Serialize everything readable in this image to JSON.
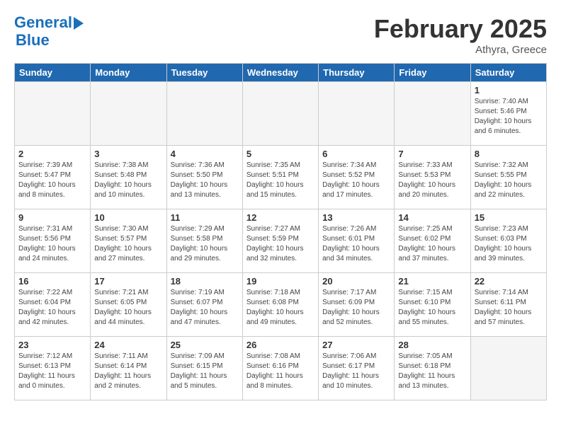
{
  "logo": {
    "line1": "General",
    "line2": "Blue"
  },
  "title": "February 2025",
  "subtitle": "Athyra, Greece",
  "days_of_week": [
    "Sunday",
    "Monday",
    "Tuesday",
    "Wednesday",
    "Thursday",
    "Friday",
    "Saturday"
  ],
  "weeks": [
    [
      {
        "num": "",
        "info": ""
      },
      {
        "num": "",
        "info": ""
      },
      {
        "num": "",
        "info": ""
      },
      {
        "num": "",
        "info": ""
      },
      {
        "num": "",
        "info": ""
      },
      {
        "num": "",
        "info": ""
      },
      {
        "num": "1",
        "info": "Sunrise: 7:40 AM\nSunset: 5:46 PM\nDaylight: 10 hours\nand 6 minutes."
      }
    ],
    [
      {
        "num": "2",
        "info": "Sunrise: 7:39 AM\nSunset: 5:47 PM\nDaylight: 10 hours\nand 8 minutes."
      },
      {
        "num": "3",
        "info": "Sunrise: 7:38 AM\nSunset: 5:48 PM\nDaylight: 10 hours\nand 10 minutes."
      },
      {
        "num": "4",
        "info": "Sunrise: 7:36 AM\nSunset: 5:50 PM\nDaylight: 10 hours\nand 13 minutes."
      },
      {
        "num": "5",
        "info": "Sunrise: 7:35 AM\nSunset: 5:51 PM\nDaylight: 10 hours\nand 15 minutes."
      },
      {
        "num": "6",
        "info": "Sunrise: 7:34 AM\nSunset: 5:52 PM\nDaylight: 10 hours\nand 17 minutes."
      },
      {
        "num": "7",
        "info": "Sunrise: 7:33 AM\nSunset: 5:53 PM\nDaylight: 10 hours\nand 20 minutes."
      },
      {
        "num": "8",
        "info": "Sunrise: 7:32 AM\nSunset: 5:55 PM\nDaylight: 10 hours\nand 22 minutes."
      }
    ],
    [
      {
        "num": "9",
        "info": "Sunrise: 7:31 AM\nSunset: 5:56 PM\nDaylight: 10 hours\nand 24 minutes."
      },
      {
        "num": "10",
        "info": "Sunrise: 7:30 AM\nSunset: 5:57 PM\nDaylight: 10 hours\nand 27 minutes."
      },
      {
        "num": "11",
        "info": "Sunrise: 7:29 AM\nSunset: 5:58 PM\nDaylight: 10 hours\nand 29 minutes."
      },
      {
        "num": "12",
        "info": "Sunrise: 7:27 AM\nSunset: 5:59 PM\nDaylight: 10 hours\nand 32 minutes."
      },
      {
        "num": "13",
        "info": "Sunrise: 7:26 AM\nSunset: 6:01 PM\nDaylight: 10 hours\nand 34 minutes."
      },
      {
        "num": "14",
        "info": "Sunrise: 7:25 AM\nSunset: 6:02 PM\nDaylight: 10 hours\nand 37 minutes."
      },
      {
        "num": "15",
        "info": "Sunrise: 7:23 AM\nSunset: 6:03 PM\nDaylight: 10 hours\nand 39 minutes."
      }
    ],
    [
      {
        "num": "16",
        "info": "Sunrise: 7:22 AM\nSunset: 6:04 PM\nDaylight: 10 hours\nand 42 minutes."
      },
      {
        "num": "17",
        "info": "Sunrise: 7:21 AM\nSunset: 6:05 PM\nDaylight: 10 hours\nand 44 minutes."
      },
      {
        "num": "18",
        "info": "Sunrise: 7:19 AM\nSunset: 6:07 PM\nDaylight: 10 hours\nand 47 minutes."
      },
      {
        "num": "19",
        "info": "Sunrise: 7:18 AM\nSunset: 6:08 PM\nDaylight: 10 hours\nand 49 minutes."
      },
      {
        "num": "20",
        "info": "Sunrise: 7:17 AM\nSunset: 6:09 PM\nDaylight: 10 hours\nand 52 minutes."
      },
      {
        "num": "21",
        "info": "Sunrise: 7:15 AM\nSunset: 6:10 PM\nDaylight: 10 hours\nand 55 minutes."
      },
      {
        "num": "22",
        "info": "Sunrise: 7:14 AM\nSunset: 6:11 PM\nDaylight: 10 hours\nand 57 minutes."
      }
    ],
    [
      {
        "num": "23",
        "info": "Sunrise: 7:12 AM\nSunset: 6:13 PM\nDaylight: 11 hours\nand 0 minutes."
      },
      {
        "num": "24",
        "info": "Sunrise: 7:11 AM\nSunset: 6:14 PM\nDaylight: 11 hours\nand 2 minutes."
      },
      {
        "num": "25",
        "info": "Sunrise: 7:09 AM\nSunset: 6:15 PM\nDaylight: 11 hours\nand 5 minutes."
      },
      {
        "num": "26",
        "info": "Sunrise: 7:08 AM\nSunset: 6:16 PM\nDaylight: 11 hours\nand 8 minutes."
      },
      {
        "num": "27",
        "info": "Sunrise: 7:06 AM\nSunset: 6:17 PM\nDaylight: 11 hours\nand 10 minutes."
      },
      {
        "num": "28",
        "info": "Sunrise: 7:05 AM\nSunset: 6:18 PM\nDaylight: 11 hours\nand 13 minutes."
      },
      {
        "num": "",
        "info": ""
      }
    ]
  ]
}
